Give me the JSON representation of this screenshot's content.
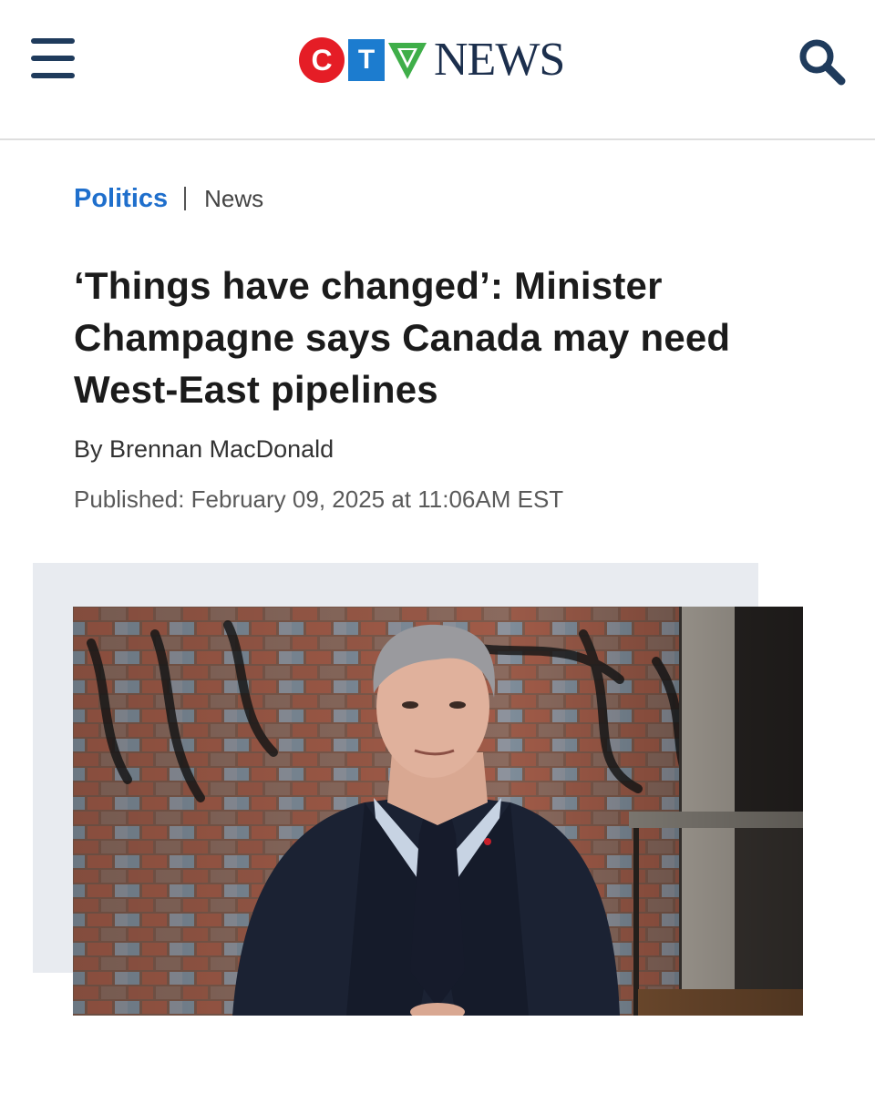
{
  "header": {
    "logo": {
      "letters": [
        "C",
        "T",
        "V"
      ],
      "word": "NEWS",
      "colors": [
        "#e51d26",
        "#1c7ccf",
        "#3fae49"
      ]
    },
    "menu_icon": "hamburger-menu-icon",
    "search_icon": "search-icon",
    "icon_color": "#1f3b5c"
  },
  "breadcrumb": {
    "section": "Politics",
    "subsection": "News"
  },
  "article": {
    "headline": "‘Things have changed’: Minister Champagne says Canada may need West-East pipelines",
    "byline_prefix": "By ",
    "author": "Brennan MacDonald",
    "published": "Published: February 09, 2025 at 11:06AM EST"
  },
  "colors": {
    "section_link": "#1f6fcc",
    "headline": "#1b1b1b",
    "image_backdrop": "#e8ebf0"
  }
}
